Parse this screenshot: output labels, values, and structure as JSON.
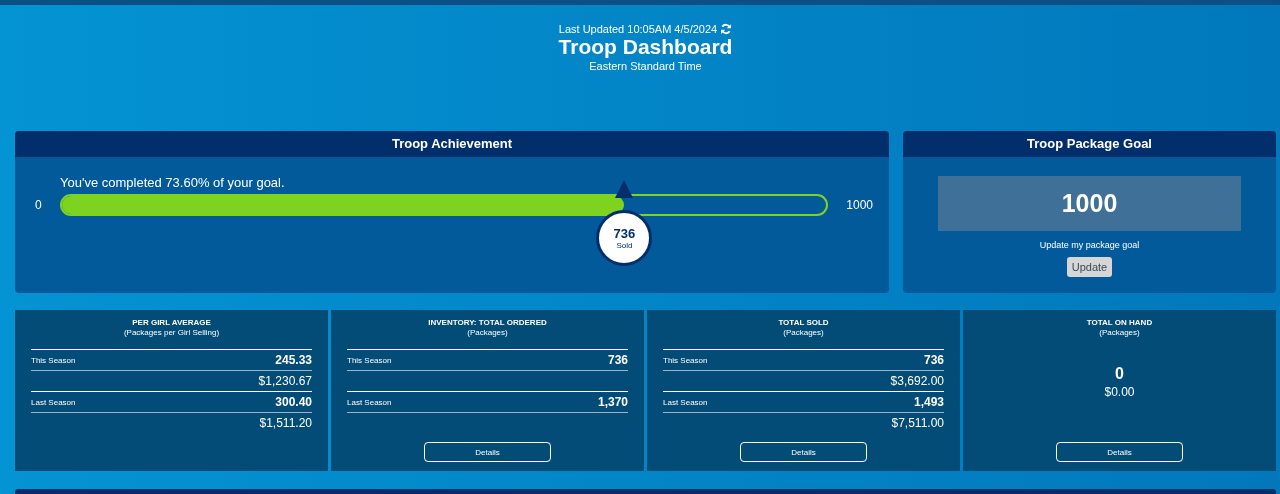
{
  "header": {
    "last_updated": "Last Updated 10:05AM 4/5/2024",
    "title": "Troop Dashboard",
    "timezone": "Eastern Standard Time"
  },
  "achievement": {
    "title": "Troop Achievement",
    "message": "You've completed 73.60% of your goal.",
    "min": "0",
    "max": "1000",
    "level": 0.736,
    "sold_value": "736",
    "sold_label": "Sold"
  },
  "goal": {
    "title": "Troop Package Goal",
    "value": "1000",
    "hint": "Update my package goal",
    "button": "Update"
  },
  "cards": [
    {
      "kind": "seasons",
      "title": "PER GIRL AVERAGE",
      "subtitle": "(Packages per Girl Selling)",
      "rows": [
        {
          "label": "This Season",
          "value": "245.33",
          "money": "$1,230.67"
        },
        {
          "label": "Last Season",
          "value": "300.40",
          "money": "$1,511.20"
        }
      ]
    },
    {
      "kind": "seasons",
      "title": "INVENTORY: TOTAL ORDERED",
      "subtitle": "(Packages)",
      "rows": [
        {
          "label": "This Season",
          "value": "736"
        },
        {
          "label": "Last Season",
          "value": "1,370"
        }
      ],
      "button": "Details"
    },
    {
      "kind": "seasons",
      "title": "TOTAL SOLD",
      "subtitle": "(Packages)",
      "rows": [
        {
          "label": "This Season",
          "value": "736",
          "money": "$3,692.00"
        },
        {
          "label": "Last Season",
          "value": "1,493",
          "money": "$7,511.00"
        }
      ],
      "button": "Details"
    },
    {
      "kind": "total",
      "title": "TOTAL ON HAND",
      "subtitle": "(Packages)",
      "value": "0",
      "money": "$0.00",
      "button": "Details"
    }
  ]
}
